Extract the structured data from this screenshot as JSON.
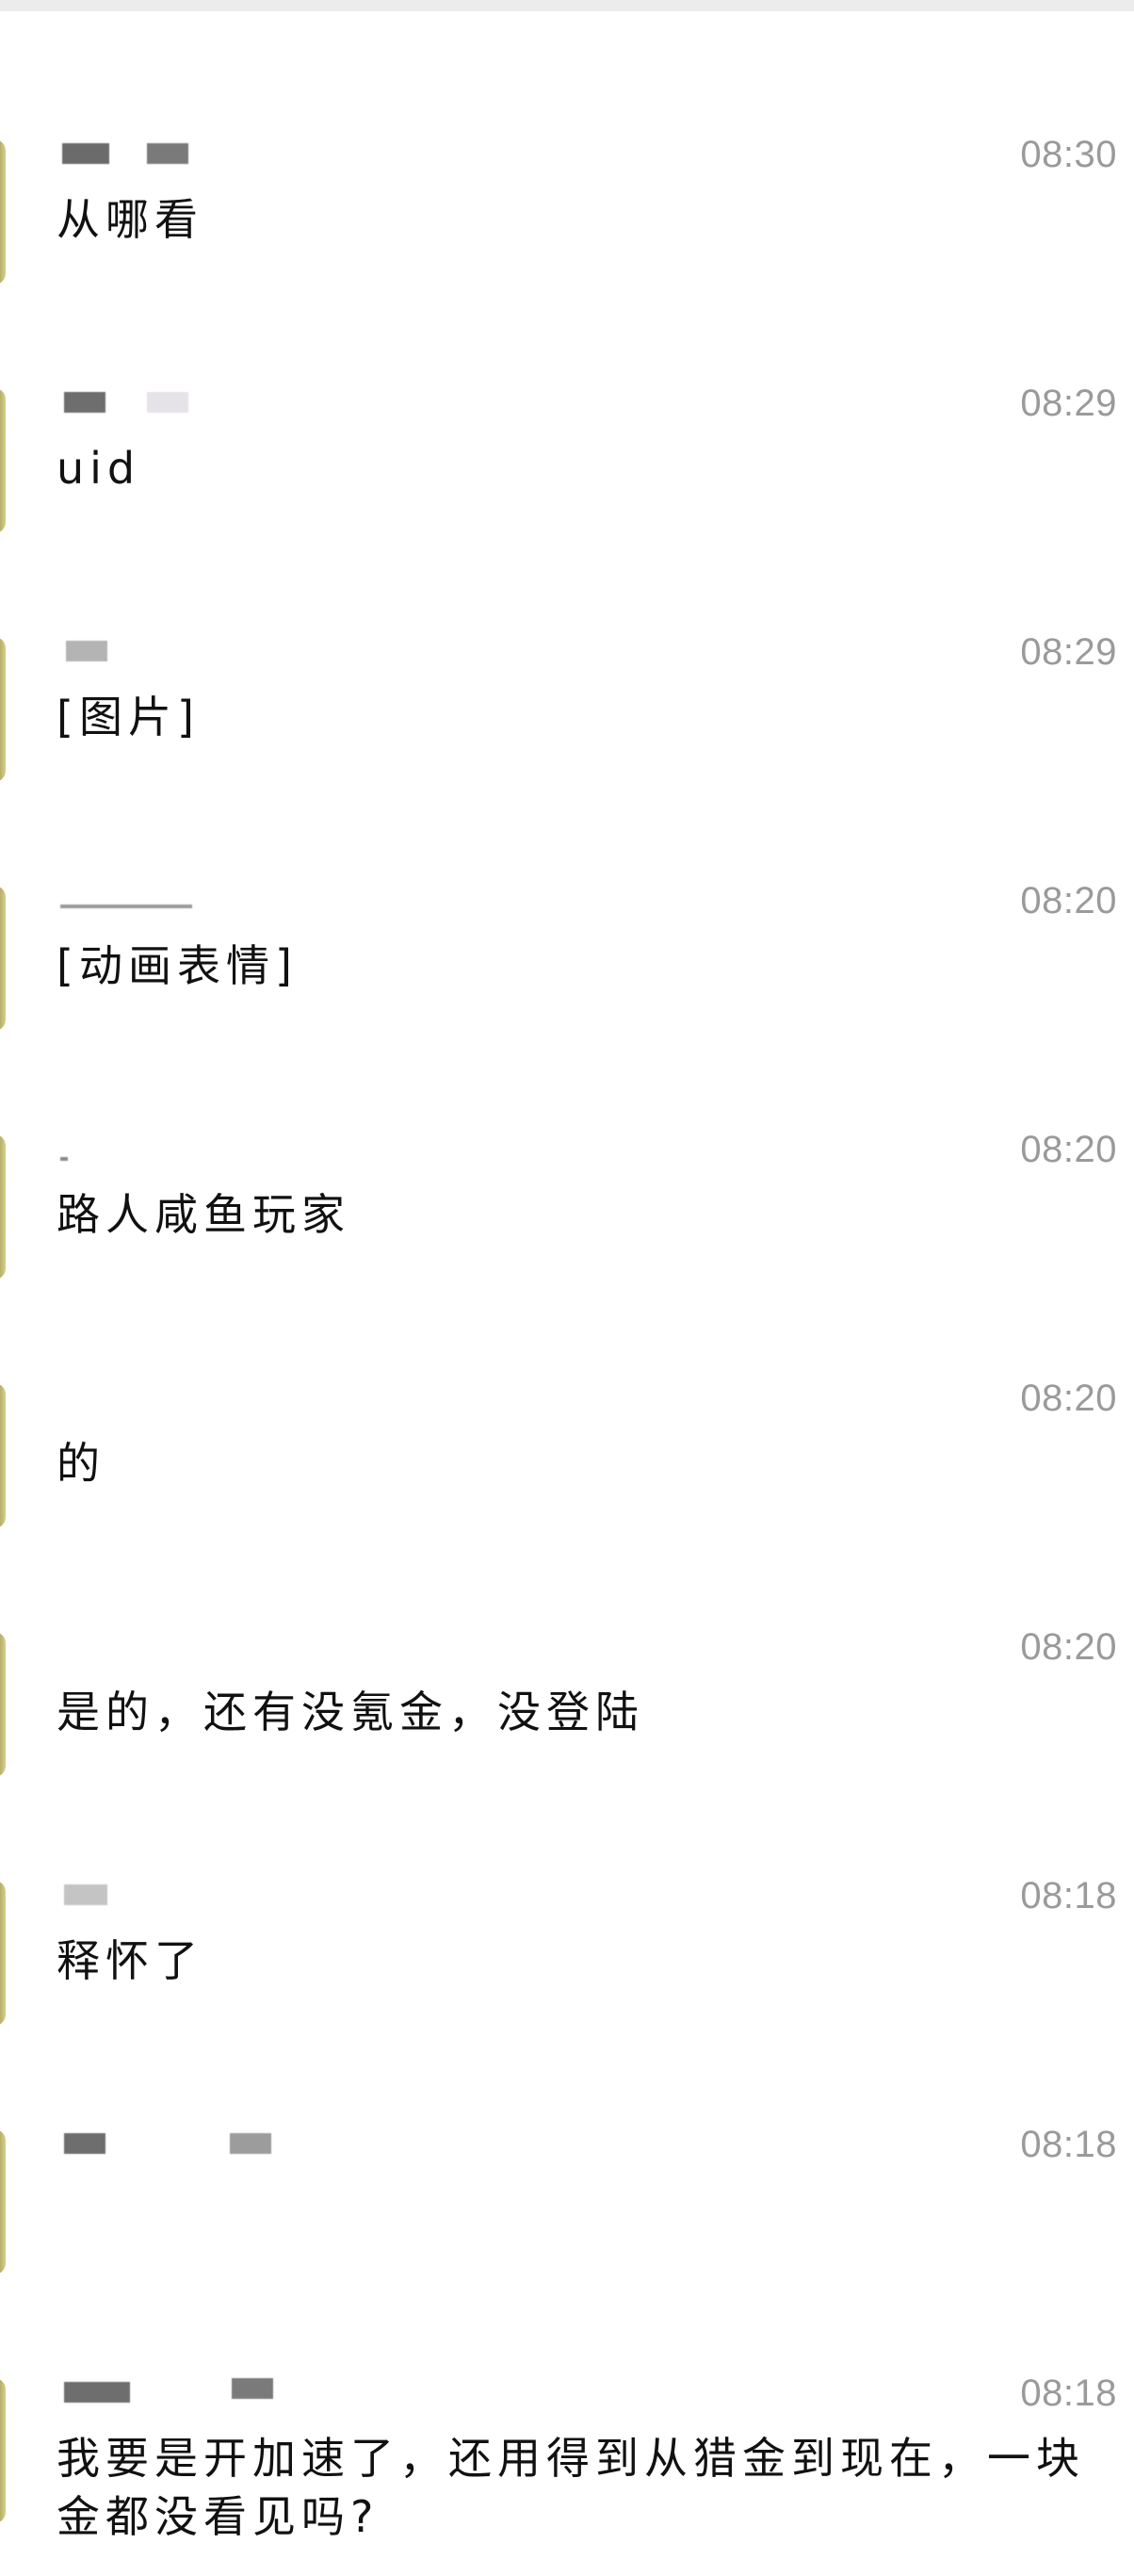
{
  "conversations": [
    {
      "time": "08:30",
      "message": "从哪看"
    },
    {
      "time": "08:29",
      "message": "uid"
    },
    {
      "time": "08:29",
      "message": "[图片]"
    },
    {
      "time": "08:20",
      "message": "[动画表情]"
    },
    {
      "time": "08:20",
      "message": "路人咸鱼玩家"
    },
    {
      "time": "08:20",
      "message": "的"
    },
    {
      "time": "08:20",
      "message": "是的，还有没氪金，没登陆"
    },
    {
      "time": "08:18",
      "message": "释怀了"
    },
    {
      "time": "08:18",
      "message": ""
    },
    {
      "time": "08:18",
      "message": "我要是开加速了，还用得到从猎金到现在，一块金都没看见吗?"
    }
  ]
}
